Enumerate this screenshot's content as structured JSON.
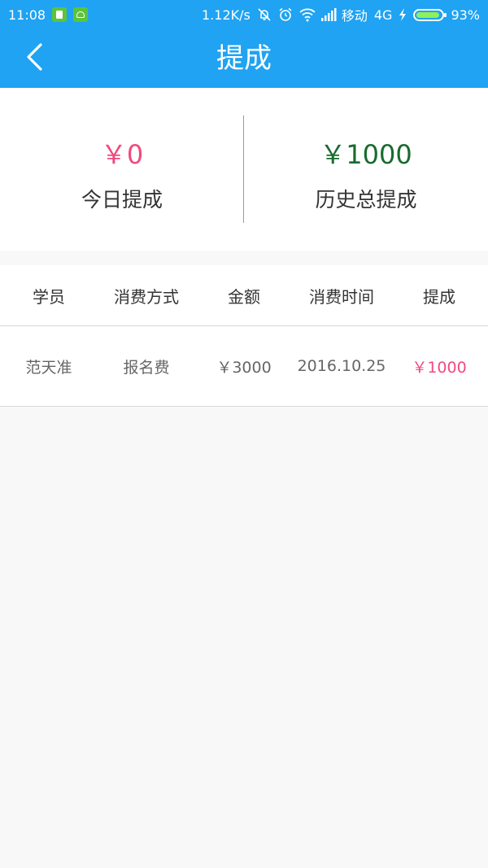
{
  "status_bar": {
    "time": "11:08",
    "speed": "1.12K/s",
    "carrier": "移动",
    "network": "4G",
    "battery_percent": "93%",
    "battery_level": 0.93
  },
  "header": {
    "title": "提成"
  },
  "summary": {
    "today": {
      "value": "￥0",
      "label": "今日提成"
    },
    "history": {
      "value": "￥1000",
      "label": "历史总提成"
    }
  },
  "table": {
    "columns": [
      "学员",
      "消费方式",
      "金额",
      "消费时间",
      "提成"
    ],
    "rows": [
      [
        "范天准",
        "报名费",
        "￥3000",
        "2016.10.25",
        "￥1000"
      ]
    ]
  },
  "colors": {
    "primary": "#1fa3f2",
    "today_value": "#f04a7e",
    "history_value": "#186b2e",
    "commission": "#f04a7e"
  },
  "icons": {
    "back": "chevron-left-icon",
    "mute": "bell-off-icon",
    "alarm": "alarm-icon",
    "wifi": "wifi-icon",
    "signal": "signal-icon",
    "charging": "lightning-icon",
    "battery": "battery-icon"
  }
}
